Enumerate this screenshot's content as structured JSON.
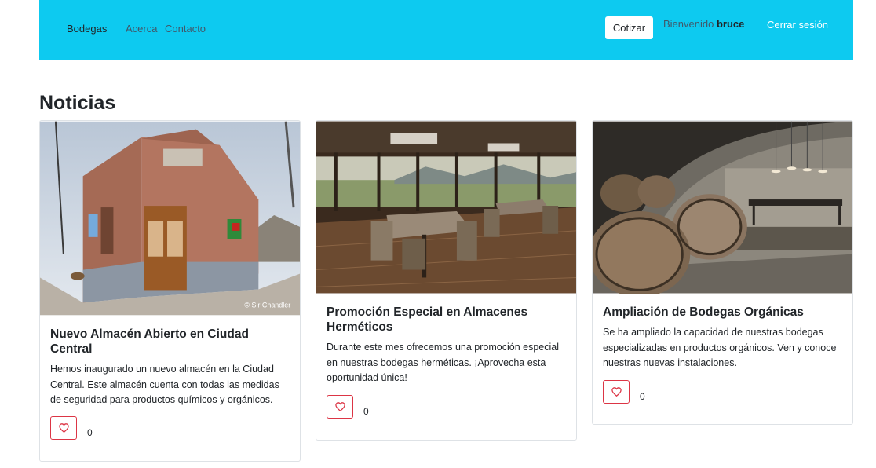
{
  "nav": {
    "brand": "Bodegas",
    "links": [
      "Acerca",
      "Contacto"
    ],
    "cotizar": "Cotizar",
    "welcome_prefix": "Bienvenido",
    "username": "bruce",
    "logout": "Cerrar sesión"
  },
  "section_title": "Noticias",
  "cards": [
    {
      "title": "Nuevo Almacén Abierto en Ciudad Central",
      "text": "Hemos inaugurado un nuevo almacén en la Ciudad Central. Este almacén cuenta con todas las medidas de seguridad para productos químicos y orgánicos.",
      "likes": "0",
      "watermark": "© Sir Chandler"
    },
    {
      "title": "Promoción Especial en Almacenes Herméticos",
      "text": "Durante este mes ofrecemos una promoción especial en nuestras bodegas herméticas. ¡Aprovecha esta oportunidad única!",
      "likes": "0"
    },
    {
      "title": "Ampliación de Bodegas Orgánicas",
      "text": "Se ha ampliado la capacidad de nuestras bodegas especializadas en productos orgánicos. Ven y conoce nuestras nuevas instalaciones.",
      "likes": "0"
    }
  ],
  "icons": {
    "like": "heart-icon"
  },
  "colors": {
    "navbar": "#0dcaf0",
    "like_border": "#dc3545"
  }
}
